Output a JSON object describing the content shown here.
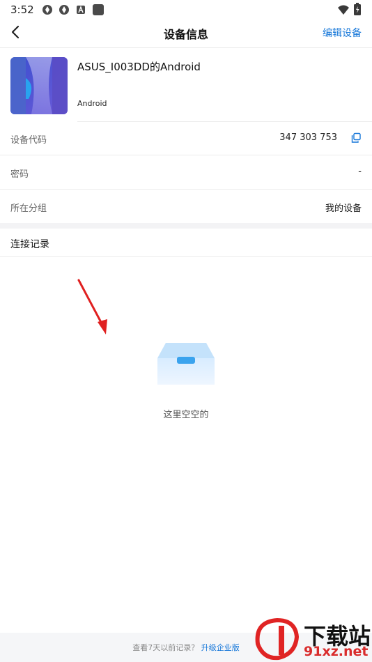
{
  "status_bar": {
    "time": "3:52",
    "icons": [
      "app-icon",
      "app-icon",
      "font-icon",
      "square-icon"
    ],
    "right_icons": [
      "wifi-icon",
      "battery-icon"
    ]
  },
  "app_bar": {
    "title": "设备信息",
    "action": "编辑设备"
  },
  "device": {
    "name": "ASUS_I003DD的Android",
    "os": "Android"
  },
  "info_rows": [
    {
      "label": "设备代码",
      "value": "347 303 753"
    },
    {
      "label": "密码",
      "value": "-"
    },
    {
      "label": "所在分组",
      "value": "我的设备"
    }
  ],
  "connection_records": {
    "title": "连接记录",
    "empty_text": "这里空空的"
  },
  "footer": {
    "prefix": "查看7天以前记录？",
    "link": "升级企业版"
  },
  "watermark": {
    "logo_text": "下载站",
    "site": "91xz.net"
  },
  "colors": {
    "accent": "#1677d9",
    "annotation_arrow": "#e02020"
  }
}
